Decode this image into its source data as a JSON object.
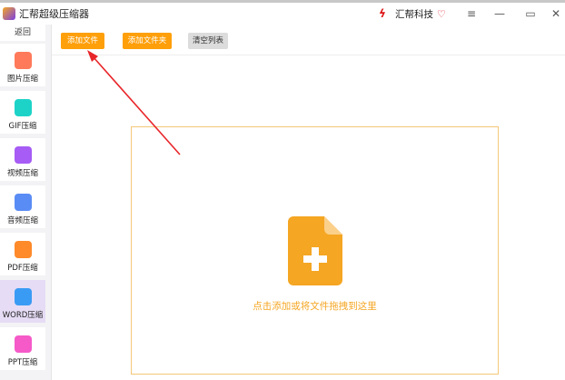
{
  "app": {
    "title": "汇帮超级压缩器",
    "brand": "汇帮科技"
  },
  "window": {
    "menu_icon": "≡",
    "minimize_icon": "—",
    "maximize_icon": "▭",
    "close_icon": "✕"
  },
  "sidebar": {
    "back": "返回",
    "items": [
      {
        "label": "图片压缩",
        "color": "#ff7a5a"
      },
      {
        "label": "GIF压缩",
        "color": "#1dd3c8"
      },
      {
        "label": "视频压缩",
        "color": "#a65cf5"
      },
      {
        "label": "音频压缩",
        "color": "#5a8cf5"
      },
      {
        "label": "PDF压缩",
        "color": "#ff8a2a"
      },
      {
        "label": "WORD压缩",
        "color": "#3a9bf5"
      },
      {
        "label": "PPT压缩",
        "color": "#f55ac8"
      }
    ],
    "selected": 5
  },
  "toolbar": {
    "add_file": "添加文件",
    "add_folder": "添加文件夹",
    "clear_list": "清空列表"
  },
  "dropzone": {
    "text": "点击添加或将文件拖拽到这里",
    "accent": "#f5a623"
  }
}
